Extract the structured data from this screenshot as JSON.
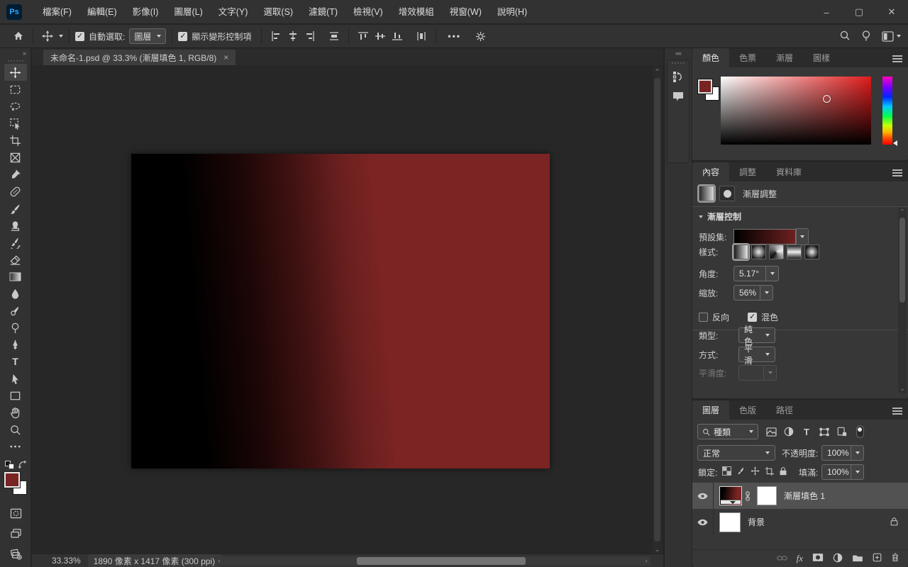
{
  "window": {
    "logo": "Ps",
    "minimize_glyph": "–",
    "maximize_glyph": "▢",
    "close_glyph": "✕"
  },
  "menubar": {
    "items": [
      "檔案(F)",
      "編輯(E)",
      "影像(I)",
      "圖層(L)",
      "文字(Y)",
      "選取(S)",
      "濾鏡(T)",
      "檢視(V)",
      "增效模組",
      "視窗(W)",
      "說明(H)"
    ]
  },
  "options": {
    "auto_select_label": "自動選取:",
    "auto_select_checked": true,
    "auto_select_value": "圖層",
    "show_transform_label": "顯示變形控制項",
    "show_transform_checked": true,
    "more_glyph": "•••",
    "icons": [
      "home-icon",
      "move-tool-icon",
      "align-left-icon",
      "align-center-h-icon",
      "align-right-icon",
      "distribute-h-icon",
      "align-top-icon",
      "align-middle-icon",
      "align-bottom-icon",
      "distribute-v-icon",
      "more-options-icon",
      "gear-icon",
      "search-icon",
      "discover-icon",
      "workspace-icon"
    ]
  },
  "toolbar": {
    "expand_glyph": "»",
    "active_tool": "move-tool",
    "tools": [
      "move-tool",
      "rectangular-marquee-tool",
      "lasso-tool",
      "object-selection-tool",
      "crop-tool",
      "frame-tool",
      "eyedropper-tool",
      "spot-healing-brush-tool",
      "brush-tool",
      "clone-stamp-tool",
      "history-brush-tool",
      "eraser-tool",
      "gradient-tool",
      "blur-tool",
      "smudge-tool",
      "dodge-tool",
      "pen-tool",
      "type-tool",
      "path-selection-tool",
      "rectangle-tool",
      "hand-tool",
      "zoom-tool",
      "edit-toolbar"
    ],
    "type_tool_glyph": "T",
    "foreground_color": "#7a2323",
    "background_color": "#ffffff"
  },
  "document": {
    "tab_title": "未命名-1.psd @ 33.3% (漸層填色 1, RGB/8)",
    "close_glyph": "×",
    "status_zoom": "33.33%",
    "status_info": "1890 像素 x 1417 像素 (300 ppi)",
    "status_chev": "〉",
    "canvas": {
      "gradient_start": "#000000",
      "gradient_end": "#7b2423",
      "angle": "5.17°",
      "scale": "56%"
    }
  },
  "dock": {
    "collapse_glyph": "««",
    "icons": [
      "history-icon",
      "comments-icon"
    ]
  },
  "color_panel": {
    "tabs": [
      "顏色",
      "色票",
      "漸層",
      "圖樣"
    ],
    "active_tab": "顏色",
    "foreground": "#7a2323",
    "background": "#ffffff",
    "hue": "#e01b1b"
  },
  "properties": {
    "tabs": [
      "內容",
      "調整",
      "資料庫"
    ],
    "active_tab": "內容",
    "header": "漸層調整",
    "section_title": "漸層控制",
    "preset_label": "預設集:",
    "style_label": "樣式:",
    "styles": [
      "linear",
      "radial",
      "angle",
      "reflected",
      "diamond"
    ],
    "selected_style": "linear",
    "angle_label": "角度:",
    "angle_value": "5.17°",
    "scale_label": "縮放:",
    "scale_value": "56%",
    "reverse_label": "反向",
    "reverse_checked": false,
    "dither_label": "混色",
    "dither_checked": true,
    "type_label": "類型:",
    "type_value": "純色",
    "method_label": "方式:",
    "method_value": "平滑",
    "smoothness_label": "平滑度:"
  },
  "layers": {
    "tabs": [
      "圖層",
      "色版",
      "路徑"
    ],
    "active_tab": "圖層",
    "filter_label": "種類",
    "filter_icons": [
      "pixel-layer-filter-icon",
      "adjustment-layer-filter-icon",
      "type-layer-filter-icon",
      "shape-layer-filter-icon",
      "smart-object-filter-icon",
      "filter-toggle"
    ],
    "blend_mode": "正常",
    "opacity_label": "不透明度:",
    "opacity_value": "100%",
    "lock_label": "鎖定:",
    "lock_icons": [
      "lock-transparency-icon",
      "lock-pixels-icon",
      "lock-position-icon",
      "lock-artboard-icon",
      "lock-all-icon"
    ],
    "fill_label": "填滿:",
    "fill_value": "100%",
    "fx_glyph": "fx",
    "rows": [
      {
        "name": "漸層填色 1",
        "selected": true,
        "visible": true,
        "has_mask": true
      },
      {
        "name": "背景",
        "selected": false,
        "visible": true,
        "locked": true
      }
    ],
    "bottom_icons": [
      "link-layers-icon",
      "layer-styles-icon",
      "add-mask-icon",
      "new-adjustment-icon",
      "new-group-icon",
      "new-layer-icon",
      "delete-layer-icon"
    ]
  }
}
